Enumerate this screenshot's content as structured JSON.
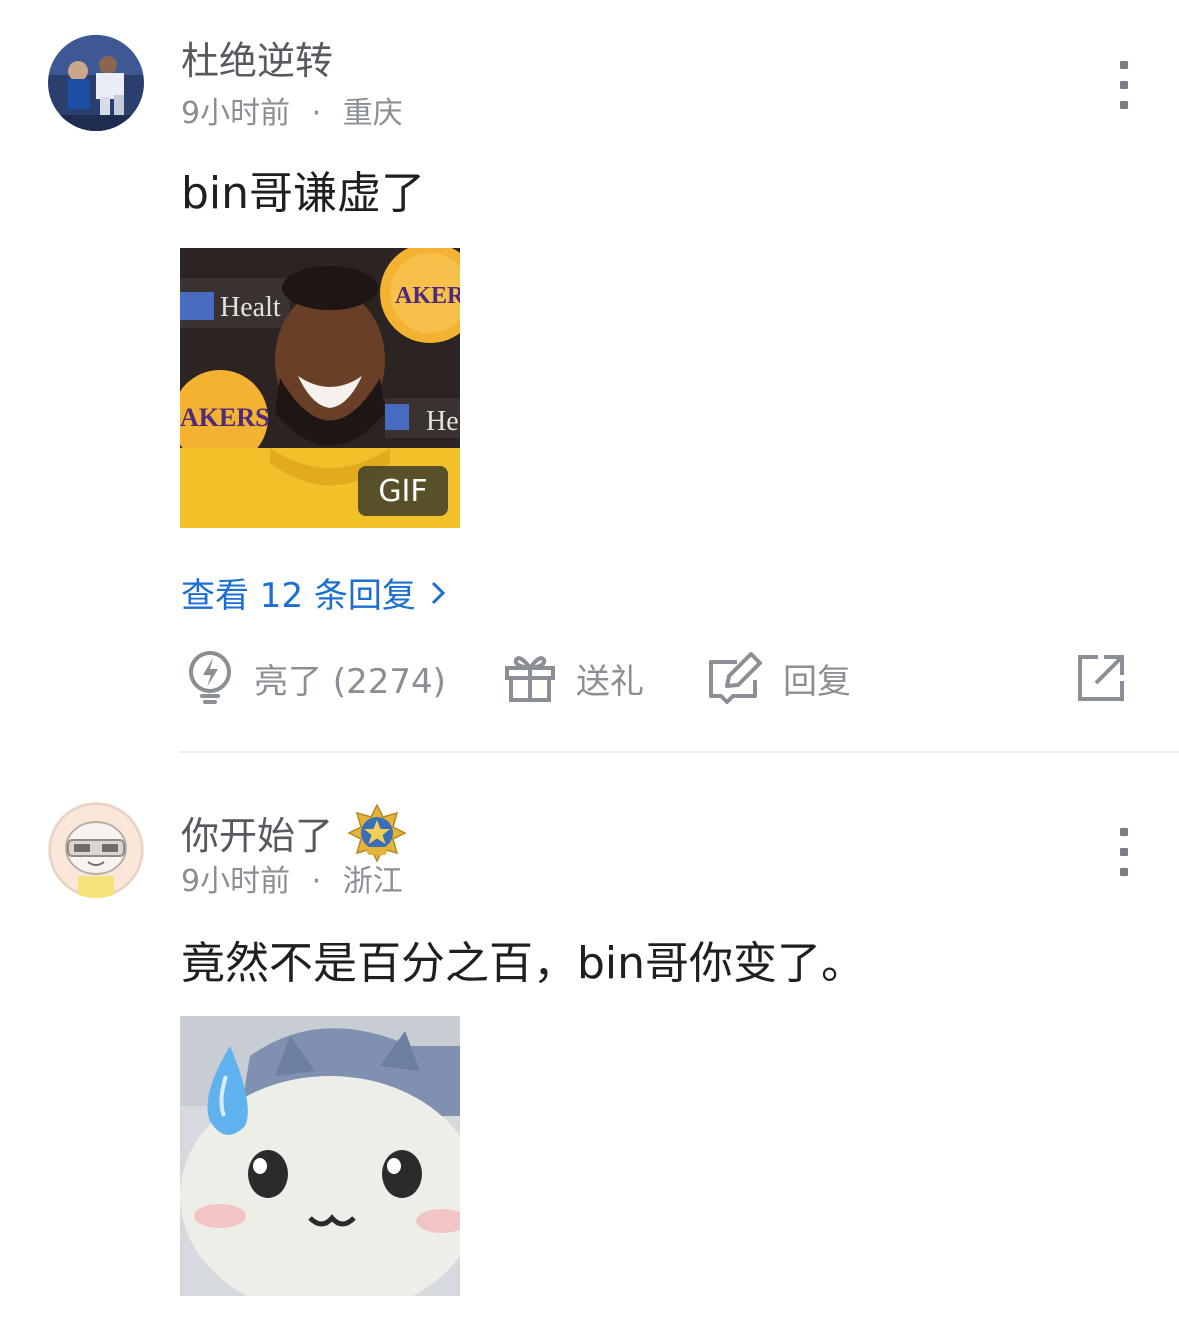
{
  "comments": [
    {
      "username": "杜绝逆转",
      "time": "9小时前",
      "separator": "·",
      "location": "重庆",
      "text": "bin哥谦虚了",
      "media_badge": "GIF",
      "view_replies_label": "查看 12 条回复",
      "actions": {
        "like_label": "亮了 (2274)",
        "gift_label": "送礼",
        "reply_label": "回复"
      }
    },
    {
      "username": "你开始了",
      "time": "9小时前",
      "separator": "·",
      "location": "浙江",
      "text": "竟然不是百分之百，bin哥你变了。"
    }
  ],
  "icons": {
    "more": "more-vertical-icon",
    "like": "lightning-bulb-icon",
    "gift": "gift-icon",
    "reply": "edit-icon",
    "share": "share-external-icon",
    "chevron": "chevron-right-icon",
    "badge": "star-medal-icon"
  },
  "colors": {
    "link": "#1a6fd1",
    "meta": "#8a8f95",
    "username": "#555a60",
    "text": "#1f1f1f"
  }
}
